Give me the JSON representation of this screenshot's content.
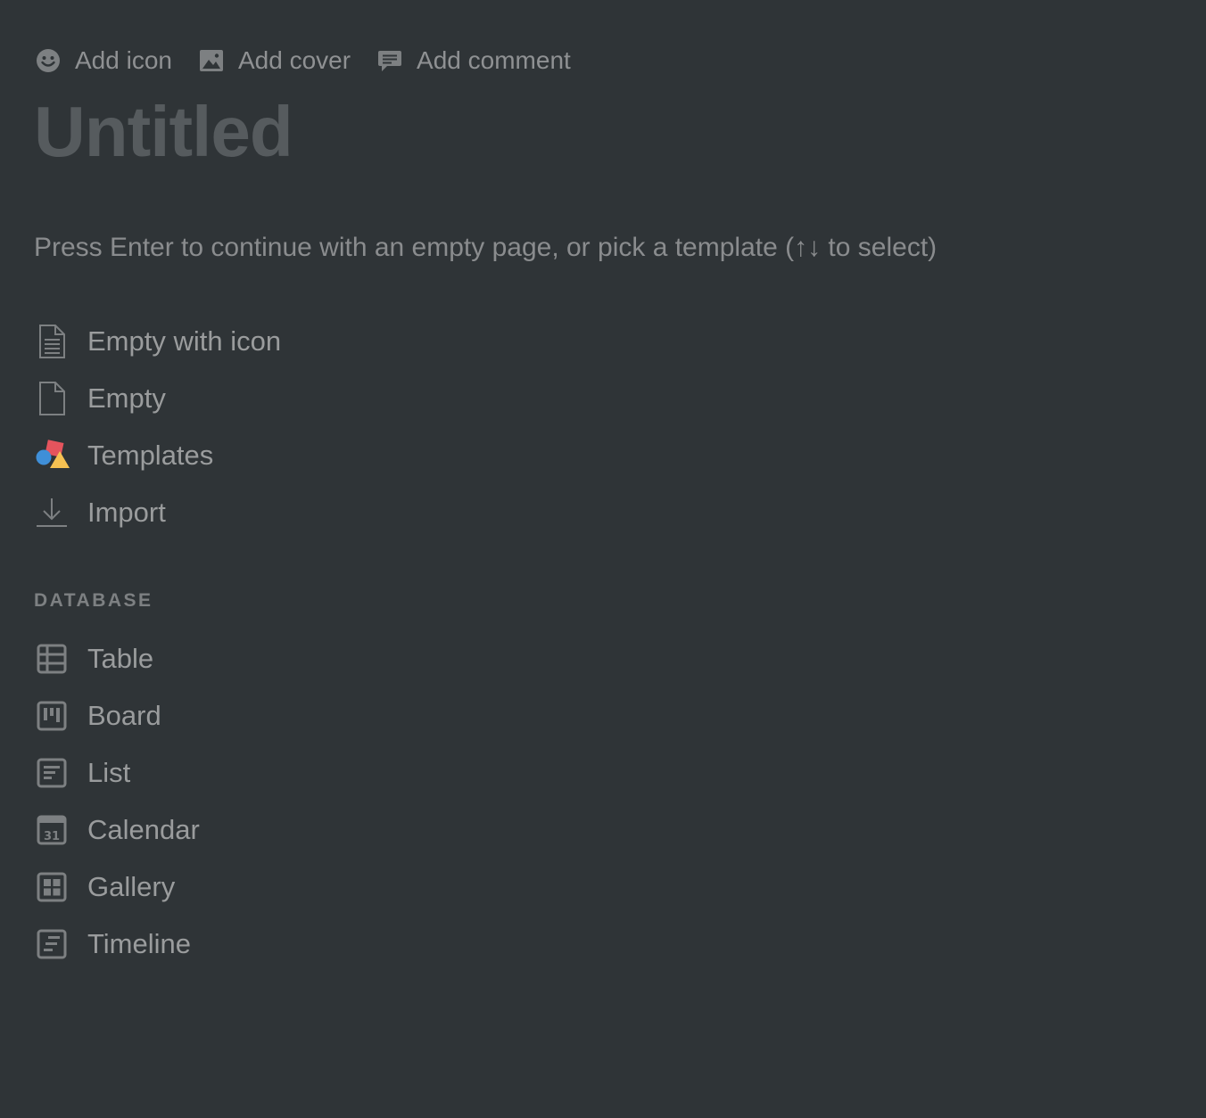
{
  "top_actions": {
    "add_icon": "Add icon",
    "add_cover": "Add cover",
    "add_comment": "Add comment"
  },
  "page": {
    "title": "Untitled",
    "hint": "Press Enter to continue with an empty page, or pick a template (↑↓ to select)"
  },
  "page_options": [
    {
      "label": "Empty with icon",
      "icon": "document-lines-icon"
    },
    {
      "label": "Empty",
      "icon": "document-icon"
    },
    {
      "label": "Templates",
      "icon": "templates-shapes-icon"
    },
    {
      "label": "Import",
      "icon": "download-icon"
    }
  ],
  "database": {
    "section_label": "DATABASE",
    "items": [
      {
        "label": "Table",
        "icon": "table-icon"
      },
      {
        "label": "Board",
        "icon": "board-icon"
      },
      {
        "label": "List",
        "icon": "list-icon"
      },
      {
        "label": "Calendar",
        "icon": "calendar-icon",
        "icon_text": "31"
      },
      {
        "label": "Gallery",
        "icon": "gallery-icon"
      },
      {
        "label": "Timeline",
        "icon": "timeline-icon"
      }
    ]
  },
  "colors": {
    "background": "#2f3437",
    "text": "#9a9c9d",
    "title": "#565b5e",
    "icon": "#7d8082",
    "templates_red": "#e5545d",
    "templates_blue": "#3f8fd8",
    "templates_yellow": "#f6c152"
  }
}
